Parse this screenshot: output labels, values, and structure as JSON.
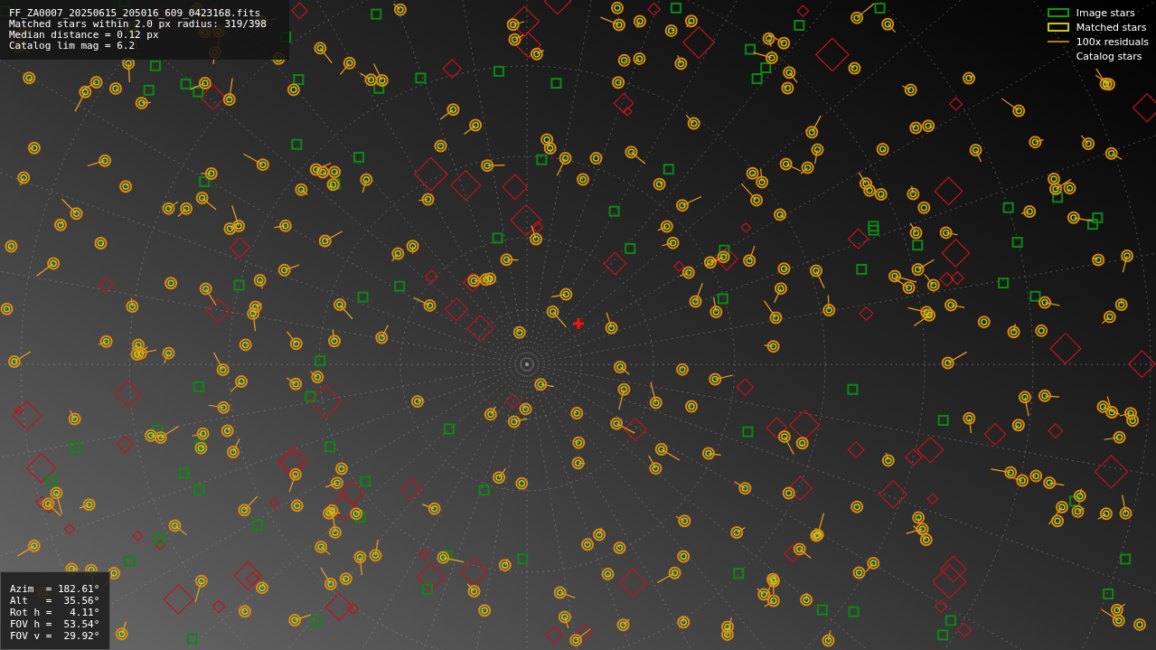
{
  "info": {
    "lines": [
      "FF_ZA0007_20250615_205016_609_0423168.fits",
      "Matched stars within 2.0 px radius: 319/398",
      "Median distance = 0.12 px",
      "Catalog lim mag = 6.2"
    ]
  },
  "pointing": {
    "lines": [
      "Azim  = 182.61°",
      "Alt   =  35.56°",
      "Rot h =   4.11°",
      "FOV h =  53.54°",
      "FOV v =  29.92°"
    ]
  },
  "legend": [
    {
      "label": "Image stars",
      "kind": "image"
    },
    {
      "label": "Matched stars",
      "kind": "matched"
    },
    {
      "label": "100x residuals",
      "kind": "residual"
    },
    {
      "label": "Catalog stars",
      "kind": "catalog"
    }
  ]
}
